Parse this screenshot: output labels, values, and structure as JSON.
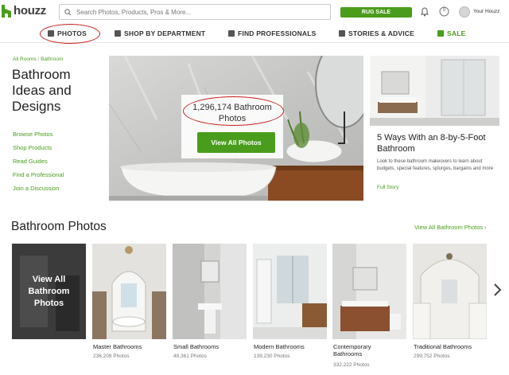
{
  "header": {
    "logo_text": "houzz",
    "search_placeholder": "Search Photos, Products, Pros & More...",
    "promo_label": "RUG SALE",
    "notifications_badge": "0",
    "profile_label": "Your Houzz"
  },
  "nav": {
    "items": [
      {
        "label": "PHOTOS"
      },
      {
        "label": "SHOP BY DEPARTMENT"
      },
      {
        "label": "FIND PROFESSIONALS"
      },
      {
        "label": "STORIES & ADVICE"
      },
      {
        "label": "SALE"
      }
    ]
  },
  "sidebar": {
    "breadcrumb": [
      "All Rooms",
      "/",
      "Bathroom"
    ],
    "title": "Bathroom Ideas and Designs",
    "links": [
      "Browse Photos",
      "Shop Products",
      "Read Guides",
      "Find a Professional",
      "Join a Discussion"
    ]
  },
  "hero": {
    "count_line1": "1,296,174 Bathroom",
    "count_line2": "Photos",
    "button_label": "View All Photos"
  },
  "article": {
    "title": "5 Ways With an 8-by-5-Foot Bathroom",
    "description": "Look to these bathroom makeovers to learn about budgets, special features, splurges, bargains and more",
    "link_label": "Full Story"
  },
  "photos_section": {
    "title": "Bathroom Photos",
    "view_all_link": "View All Bathroom Photos",
    "view_all_tile": [
      "View All",
      "Bathroom",
      "Photos"
    ],
    "categories": [
      {
        "label": "Master Bathrooms",
        "count": "236,208 Photos"
      },
      {
        "label": "Small Bathrooms",
        "count": "49,361 Photos"
      },
      {
        "label": "Modern Bathrooms",
        "count": "139,230 Photos"
      },
      {
        "label": "Contemporary",
        "label2": "Bathrooms",
        "count": "332,222 Photos"
      },
      {
        "label": "Traditional Bathrooms",
        "count": "299,752 Photos"
      }
    ]
  },
  "colors": {
    "brand_green": "#4a9d1c",
    "annotation_red": "#c8201a"
  }
}
